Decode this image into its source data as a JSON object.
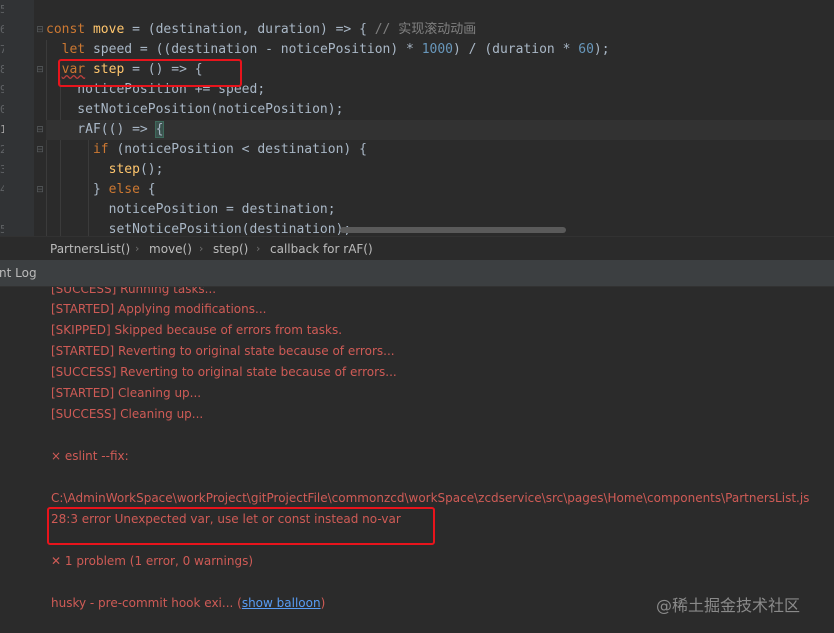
{
  "editor": {
    "line_numbers": [
      "5",
      "6",
      "7",
      "8",
      "9",
      "0",
      "1",
      "2",
      "3",
      "4",
      "5"
    ],
    "lines": [
      {
        "tokens": []
      },
      {
        "tokens": [
          {
            "t": "const ",
            "c": "kw"
          },
          {
            "t": "move",
            "c": "fn"
          },
          {
            "t": " = (destination, duration) => { ",
            "c": ""
          },
          {
            "t": "// 实现滚动动画",
            "c": "cm"
          }
        ]
      },
      {
        "tokens": [
          {
            "t": "  ",
            "c": ""
          },
          {
            "t": "let ",
            "c": "kw"
          },
          {
            "t": "speed = ((destination - noticePosition) * ",
            "c": ""
          },
          {
            "t": "1000",
            "c": "num"
          },
          {
            "t": ") / (duration * ",
            "c": ""
          },
          {
            "t": "60",
            "c": "num"
          },
          {
            "t": ");",
            "c": ""
          }
        ]
      },
      {
        "tokens": [
          {
            "t": "  ",
            "c": ""
          },
          {
            "t": "var",
            "c": "kw squig"
          },
          {
            "t": " ",
            "c": ""
          },
          {
            "t": "step",
            "c": "fn"
          },
          {
            "t": " = () => {",
            "c": ""
          }
        ]
      },
      {
        "tokens": [
          {
            "t": "    noticePosition += speed;",
            "c": ""
          }
        ]
      },
      {
        "tokens": [
          {
            "t": "    setNoticePosition(noticePosition);",
            "c": ""
          }
        ]
      },
      {
        "tokens": [
          {
            "t": "    rAF(() => ",
            "c": ""
          },
          {
            "t": "{",
            "c": "bracket"
          }
        ]
      },
      {
        "tokens": [
          {
            "t": "      ",
            "c": ""
          },
          {
            "t": "if ",
            "c": "kw"
          },
          {
            "t": "(noticePosition < destination) {",
            "c": ""
          }
        ]
      },
      {
        "tokens": [
          {
            "t": "        ",
            "c": ""
          },
          {
            "t": "step",
            "c": "fn"
          },
          {
            "t": "();",
            "c": ""
          }
        ]
      },
      {
        "tokens": [
          {
            "t": "      } ",
            "c": ""
          },
          {
            "t": "else ",
            "c": "kw"
          },
          {
            "t": "{",
            "c": ""
          }
        ]
      },
      {
        "tokens": [
          {
            "t": "        noticePosition = destination;",
            "c": ""
          }
        ]
      },
      {
        "tokens": [
          {
            "t": "        setNoticePosition(destination);",
            "c": ""
          }
        ]
      }
    ]
  },
  "breadcrumb": {
    "items": [
      "PartnersList()",
      "move()",
      "step()",
      "callback for rAF()"
    ],
    "separator": "›"
  },
  "panel": {
    "title": "nt Log"
  },
  "log": {
    "running": "[SUCCESS] Running tasks...",
    "applying": "[STARTED] Applying modifications...",
    "skipped": "[SKIPPED] Skipped because of errors from tasks.",
    "reverting_started": "[STARTED] Reverting to original state because of errors...",
    "reverting_success": "[SUCCESS] Reverting to original state because of errors...",
    "cleaning_started": "[STARTED] Cleaning up...",
    "cleaning_success": "[SUCCESS] Cleaning up...",
    "eslint_cmd": "× eslint --fix:",
    "file_path": "C:\\AdminWorkSpace\\workProject\\gitProjectFile\\commonzcd\\workSpace\\zcdservice\\src\\pages\\Home\\components\\PartnersList.js",
    "error_line": "28:3  error  Unexpected var, use let or const instead  no-var",
    "summary": "✕ 1 problem (1 error, 0 warnings)",
    "husky_prefix": "husky - pre-commit hook exi... (",
    "husky_link": "show balloon",
    "husky_suffix": ")"
  },
  "watermark": "@稀土掘金技术社区",
  "colors": {
    "annotation": "#e8141c",
    "error_text": "#cf5b56",
    "link": "#589df6"
  }
}
